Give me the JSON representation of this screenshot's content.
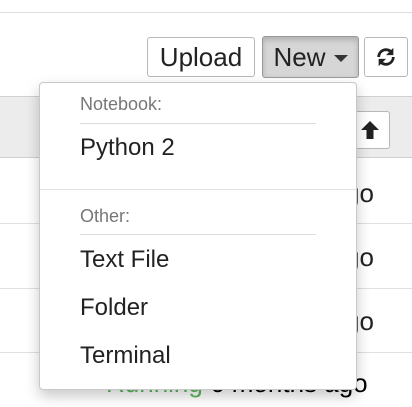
{
  "toolbar": {
    "upload_label": "Upload",
    "new_label": "New",
    "refresh_icon": "refresh-icon"
  },
  "list": {
    "sort_icon": "arrow-up-icon",
    "rows": [
      {
        "modified": "go"
      },
      {
        "modified": "go"
      },
      {
        "modified": "go"
      },
      {
        "status": "Running",
        "modified": "6 months ago"
      }
    ]
  },
  "new_menu": {
    "notebook_header": "Notebook:",
    "notebook_items": [
      "Python 2"
    ],
    "other_header": "Other:",
    "other_items": [
      "Text File",
      "Folder",
      "Terminal"
    ]
  },
  "colors": {
    "running": "#5cb85c",
    "new_active_bg": "#d6d6d6"
  }
}
